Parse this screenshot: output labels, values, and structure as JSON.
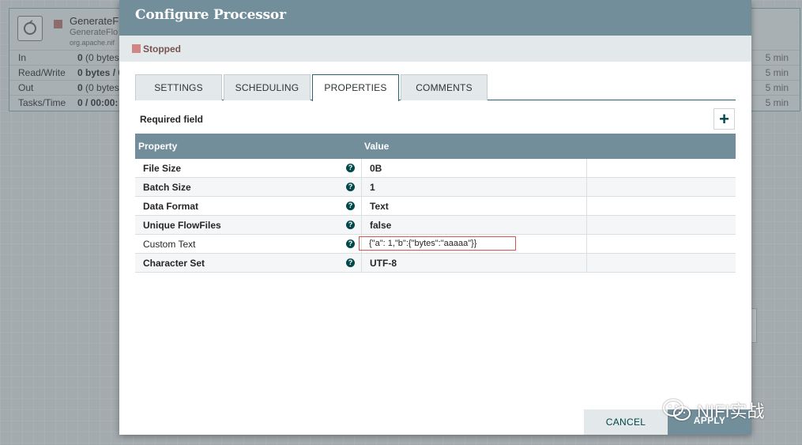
{
  "canvas": {
    "processor": {
      "name": "GenerateF",
      "type": "GenerateFlo",
      "bundle": "org.apache.nif",
      "stats": [
        {
          "label": "In",
          "value_bold": "0",
          "value_rest": "(0 bytes",
          "period": "5 min"
        },
        {
          "label": "Read/Write",
          "value_bold": "0 bytes / 0",
          "value_rest": "",
          "period": "5 min"
        },
        {
          "label": "Out",
          "value_bold": "0",
          "value_rest": "(0 bytes",
          "period": "5 min"
        },
        {
          "label": "Tasks/Time",
          "value_bold": "0 / 00:00:",
          "value_rest": "",
          "period": "5 min"
        }
      ]
    }
  },
  "dialog": {
    "title": "Configure Processor",
    "status": "Stopped",
    "tabs": [
      {
        "label": "SETTINGS",
        "active": false
      },
      {
        "label": "SCHEDULING",
        "active": false
      },
      {
        "label": "PROPERTIES",
        "active": true
      },
      {
        "label": "COMMENTS",
        "active": false
      }
    ],
    "required_field_label": "Required field",
    "add_button_label": "+",
    "table": {
      "header_property": "Property",
      "header_value": "Value",
      "rows": [
        {
          "name": "File Size",
          "value": "0B",
          "required": true
        },
        {
          "name": "Batch Size",
          "value": "1",
          "required": true
        },
        {
          "name": "Data Format",
          "value": "Text",
          "required": true
        },
        {
          "name": "Unique FlowFiles",
          "value": "false",
          "required": true
        },
        {
          "name": "Custom Text",
          "value": "{\"a\": 1,\"b\":{\"bytes\":\"aaaaa\"}}",
          "required": false
        },
        {
          "name": "Character Set",
          "value": "UTF-8",
          "required": true
        }
      ]
    },
    "cancel_label": "CANCEL",
    "apply_label": "APPLY"
  },
  "watermark": {
    "text": "NIFI实战"
  },
  "colors": {
    "header": "#728e9b",
    "accent": "#004849",
    "stopped": "#d18686",
    "highlight": "#d9534f"
  }
}
